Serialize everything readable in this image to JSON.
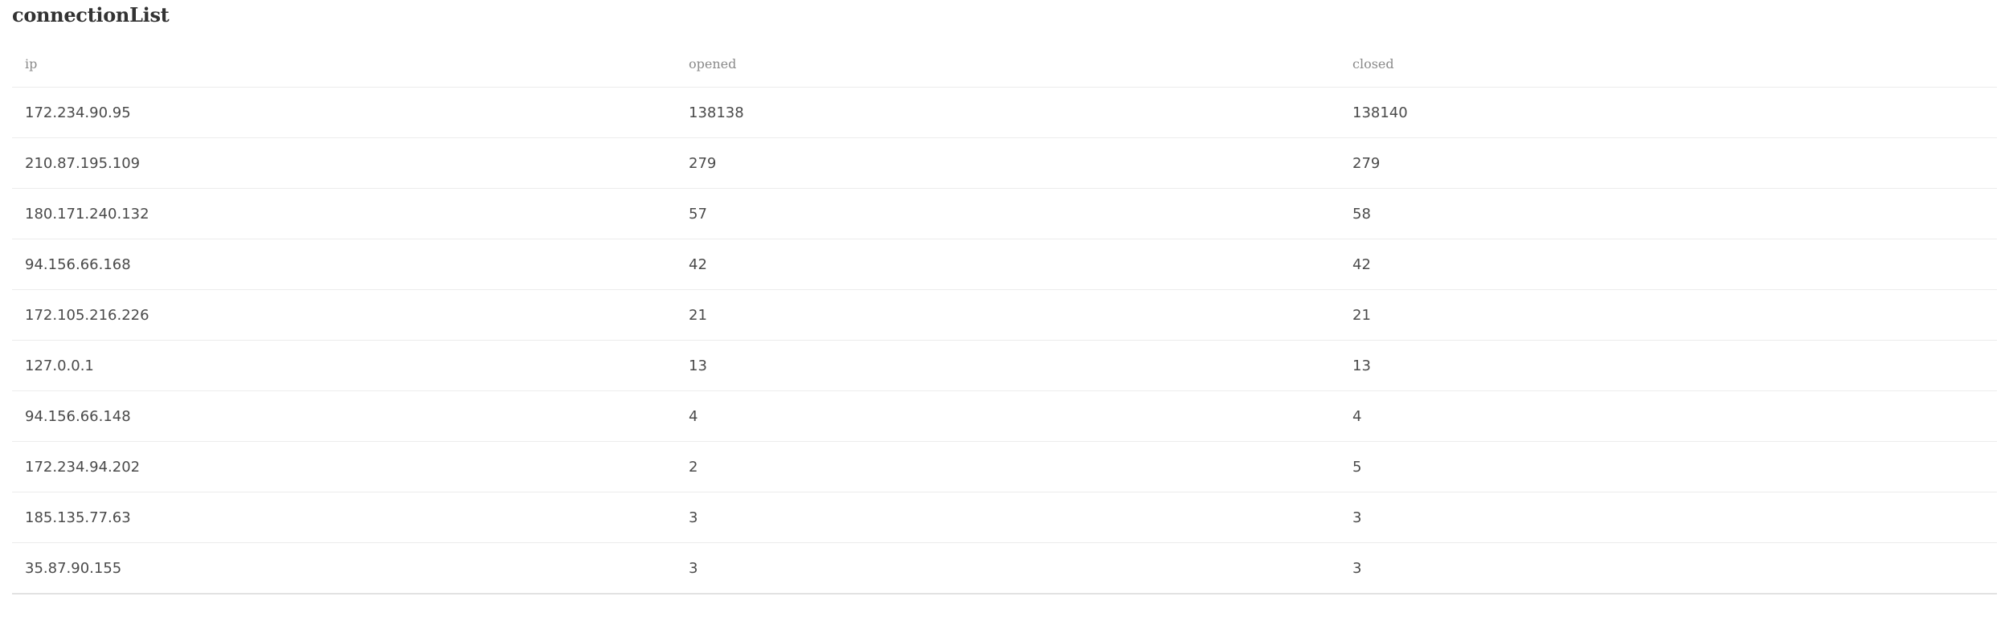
{
  "title": "connectionList",
  "table": {
    "headers": [
      "ip",
      "opened",
      "closed"
    ],
    "rows": [
      [
        "172.234.90.95",
        "138138",
        "138140"
      ],
      [
        "210.87.195.109",
        "279",
        "279"
      ],
      [
        "180.171.240.132",
        "57",
        "58"
      ],
      [
        "94.156.66.168",
        "42",
        "42"
      ],
      [
        "172.105.216.226",
        "21",
        "21"
      ],
      [
        "127.0.0.1",
        "13",
        "13"
      ],
      [
        "94.156.66.148",
        "4",
        "4"
      ],
      [
        "172.234.94.202",
        "2",
        "5"
      ],
      [
        "185.135.77.63",
        "3",
        "3"
      ],
      [
        "35.87.90.155",
        "3",
        "3"
      ]
    ]
  }
}
